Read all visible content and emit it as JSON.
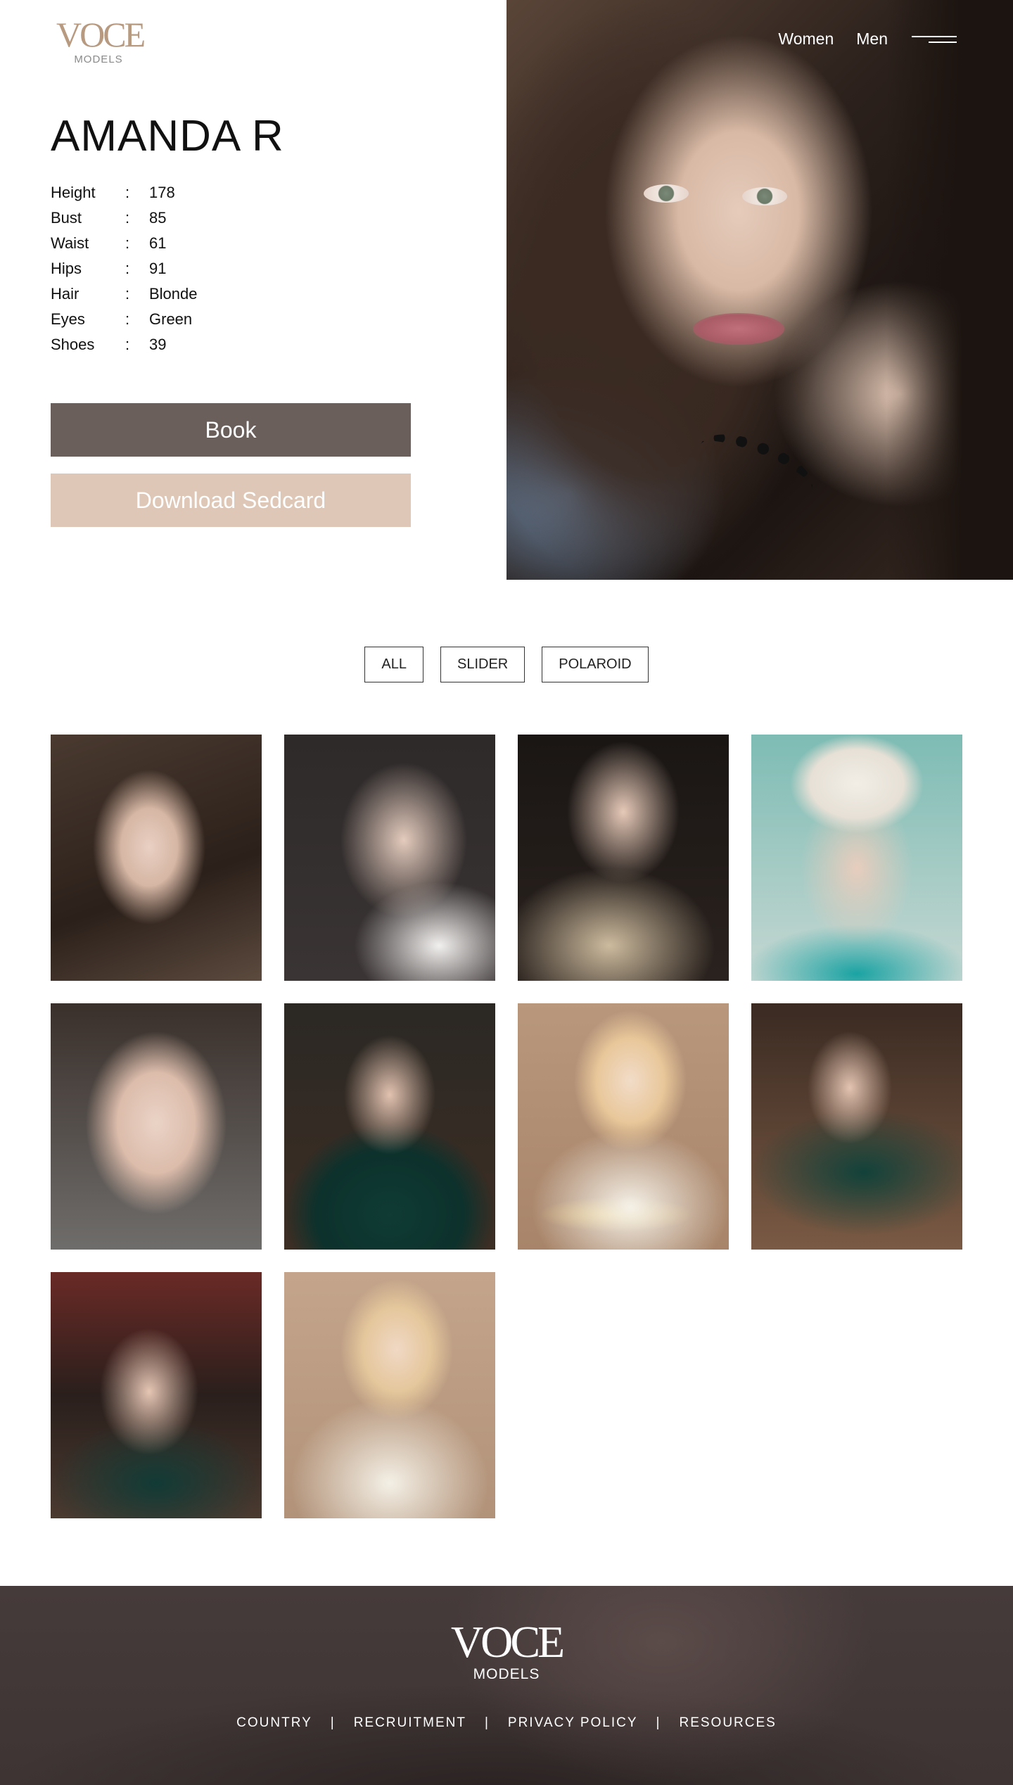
{
  "brand": {
    "logo": "VOCE",
    "logo_sub": "MODELS"
  },
  "nav": {
    "women": "Women",
    "men": "Men"
  },
  "model": {
    "name": "AMANDA R",
    "separator": ":",
    "measurements": [
      {
        "label": "Height",
        "value": "178"
      },
      {
        "label": "Bust",
        "value": "85"
      },
      {
        "label": "Waist",
        "value": "61"
      },
      {
        "label": "Hips",
        "value": "91"
      },
      {
        "label": "Hair",
        "value": "Blonde"
      },
      {
        "label": "Eyes",
        "value": "Green"
      },
      {
        "label": "Shoes",
        "value": "39"
      }
    ]
  },
  "actions": {
    "book": "Book",
    "download_sedcard": "Download Sedcard"
  },
  "filters": [
    "ALL",
    "SLIDER",
    "POLAROID"
  ],
  "footer": {
    "logo": "VOCE",
    "logo_sub": "MODELS",
    "links": [
      "COUNTRY",
      "RECRUITMENT",
      "PRIVACY POLICY",
      "RESOURCES"
    ],
    "divider": "|"
  },
  "colors": {
    "logo_accent": "#b79a80",
    "book_button": "#6b5f5c",
    "sedcard_button": "#dec7b6",
    "footer_bg": "#433838"
  },
  "icons": {
    "menu": "hamburger-menu-icon"
  }
}
